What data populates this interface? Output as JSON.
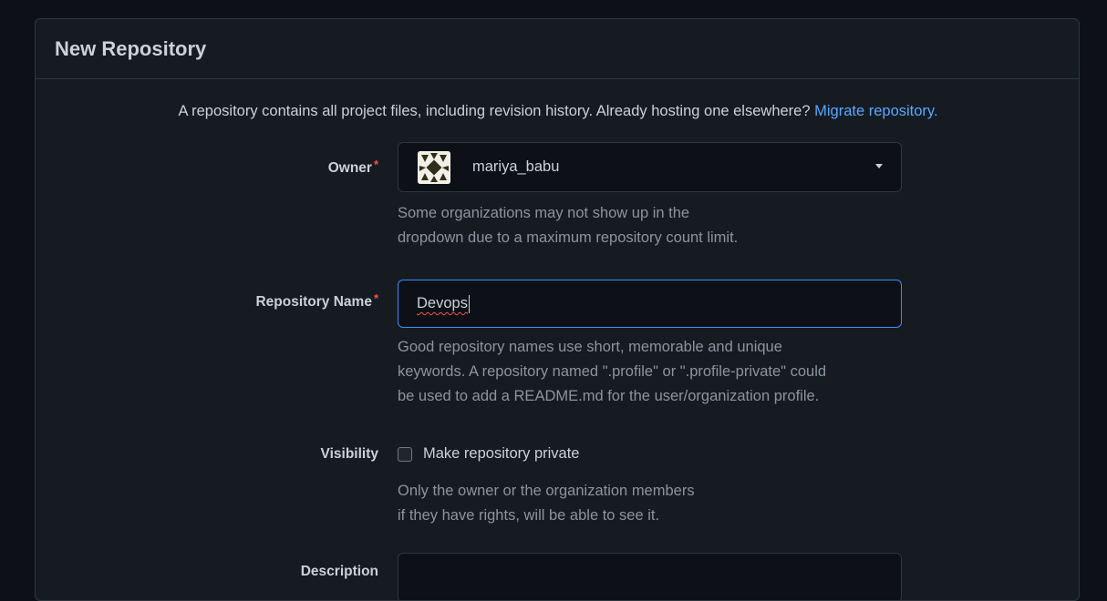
{
  "panel": {
    "title": "New Repository"
  },
  "intro": {
    "text": "A repository contains all project files, including revision history. Already hosting one elsewhere?",
    "link": "Migrate repository."
  },
  "owner": {
    "label": "Owner",
    "required_mark": "*",
    "value": "mariya_babu",
    "help_lines": [
      "Some organizations may not show up in the",
      "dropdown due to a maximum repository count limit."
    ]
  },
  "repo_name": {
    "label": "Repository Name",
    "required_mark": "*",
    "value": "Devops",
    "help_lines": [
      "Good repository names use short, memorable and unique",
      "keywords. A repository named \".profile\" or \".profile-private\" could",
      "be used to add a README.md for the user/organization profile."
    ]
  },
  "visibility": {
    "label": "Visibility",
    "checkbox_label": "Make repository private",
    "checked": false,
    "help_lines": [
      "Only the owner or the organization members",
      "if they have rights, will be able to see it."
    ]
  },
  "description": {
    "label": "Description"
  },
  "colors": {
    "background": "#0d1117",
    "panel": "#161b22",
    "border": "#30363d",
    "link": "#58a6ff",
    "required": "#f85149",
    "focus": "#388bfd",
    "muted": "#8b949e"
  }
}
